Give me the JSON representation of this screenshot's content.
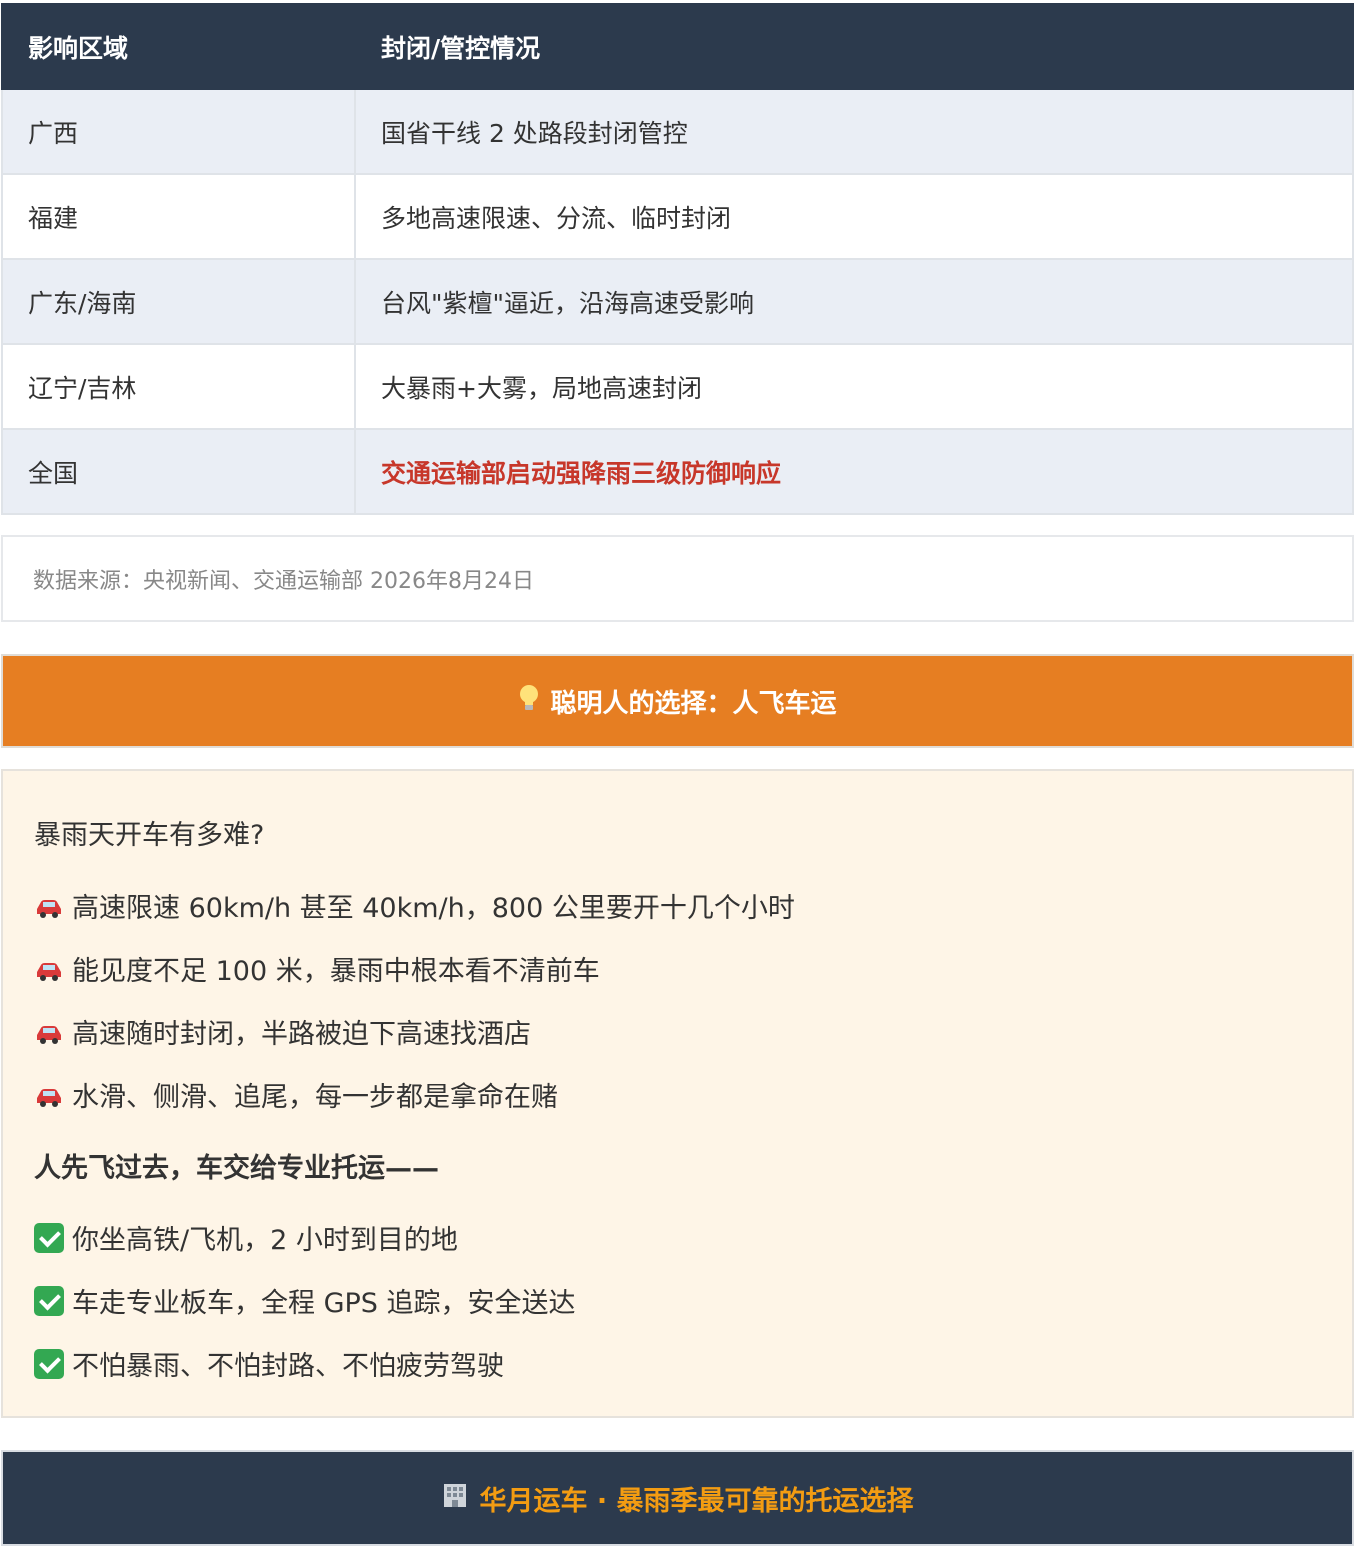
{
  "table": {
    "headers": [
      "影响区域",
      "封闭/管控情况"
    ],
    "rows": [
      {
        "region": "广西",
        "status": "国省干线 2 处路段封闭管控"
      },
      {
        "region": "福建",
        "status": "多地高速限速、分流、临时封闭"
      },
      {
        "region": "广东/海南",
        "status": "台风\"紫檀\"逼近，沿海高速受影响"
      },
      {
        "region": "辽宁/吉林",
        "status": "大暴雨+大雾，局地高速封闭"
      },
      {
        "region": "全国",
        "status": "交通运输部启动强降雨三级防御响应"
      }
    ],
    "highlight_color": "#c7372a"
  },
  "source_note": "数据来源：央视新闻、交通运输部 2026年8月24日",
  "banner": {
    "icon": "lightbulb-icon",
    "title": "聪明人的选择：人飞车运",
    "color": "#e67e22"
  },
  "content": {
    "question": "暴雨天开车有多难?",
    "problems": [
      "高速限速 60km/h 甚至 40km/h，800 公里要开十几个小时",
      "能见度不足 100 米，暴雨中根本看不清前车",
      "高速随时封闭，半路被迫下高速找酒店",
      "水滑、侧滑、追尾，每一步都是拿命在赌"
    ],
    "problem_icon": "car-icon",
    "solution_heading": "人先飞过去，车交给专业托运——",
    "benefits": [
      "你坐高铁/飞机，2 小时到目的地",
      "车走专业板车，全程 GPS 追踪，安全送达",
      "不怕暴雨、不怕封路、不怕疲劳驾驶"
    ],
    "benefit_icon": "check-icon"
  },
  "footer": {
    "icon": "building-icon",
    "title": "华月运车 · 暴雨季最可靠的托运选择",
    "color": "#f39c12"
  }
}
